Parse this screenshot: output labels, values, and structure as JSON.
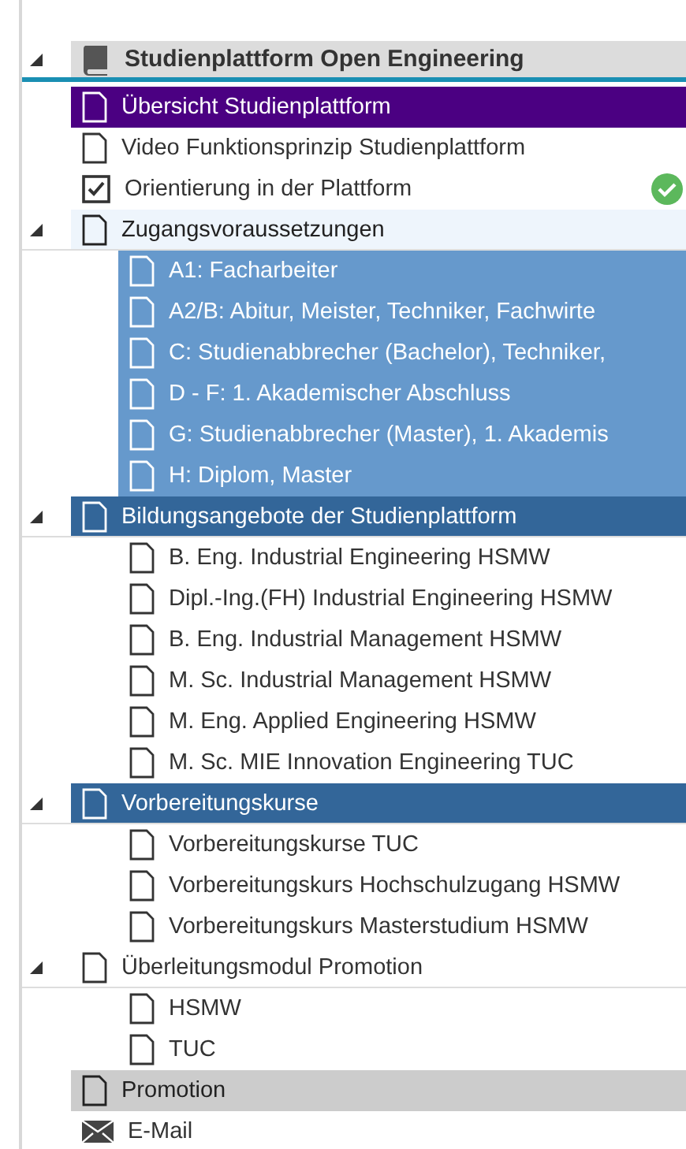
{
  "tree": {
    "label": "Studienplattform Open Engineering",
    "kind": "book",
    "expanded": true,
    "children": [
      {
        "label": "Übersicht Studienplattform",
        "kind": "page",
        "color": "#4b0082"
      },
      {
        "label": "Video Funktionsprinzip Studienplattform",
        "kind": "page"
      },
      {
        "label": "Orientierung in der Plattform",
        "kind": "checklist",
        "completed": true
      },
      {
        "label": "Zugangsvoraussetzungen",
        "kind": "page",
        "color": "#eef5fc",
        "expanded": true,
        "children": [
          {
            "label": "A1: Facharbeiter",
            "kind": "page",
            "color": "#6699cc"
          },
          {
            "label": "A2/B: Abitur, Meister, Techniker, Fachwirte",
            "kind": "page",
            "color": "#6699cc"
          },
          {
            "label": "C: Studienabbrecher (Bachelor), Techniker,",
            "kind": "page",
            "color": "#6699cc"
          },
          {
            "label": "D - F: 1. Akademischer Abschluss",
            "kind": "page",
            "color": "#6699cc"
          },
          {
            "label": "G: Studienabbrecher (Master), 1. Akademis",
            "kind": "page",
            "color": "#6699cc"
          },
          {
            "label": "H: Diplom, Master",
            "kind": "page",
            "color": "#6699cc"
          }
        ]
      },
      {
        "label": "Bildungsangebote der Studienplattform",
        "kind": "page",
        "color": "#336699",
        "expanded": true,
        "children": [
          {
            "label": "B. Eng. Industrial Engineering HSMW",
            "kind": "page"
          },
          {
            "label": "Dipl.-Ing.(FH) Industrial Engineering HSMW",
            "kind": "page"
          },
          {
            "label": "B. Eng. Industrial Management HSMW",
            "kind": "page"
          },
          {
            "label": "M. Sc. Industrial Management HSMW",
            "kind": "page"
          },
          {
            "label": "M. Eng. Applied Engineering HSMW",
            "kind": "page"
          },
          {
            "label": "M. Sc. MIE Innovation Engineering TUC",
            "kind": "page"
          }
        ]
      },
      {
        "label": "Vorbereitungskurse",
        "kind": "page",
        "color": "#336699",
        "expanded": true,
        "children": [
          {
            "label": "Vorbereitungskurse TUC",
            "kind": "page"
          },
          {
            "label": "Vorbereitungskurs Hochschulzugang HSMW",
            "kind": "page"
          },
          {
            "label": "Vorbereitungskurs Masterstudium HSMW",
            "kind": "page"
          }
        ]
      },
      {
        "label": "Überleitungsmodul Promotion",
        "kind": "page",
        "expanded": true,
        "children": [
          {
            "label": "HSMW",
            "kind": "page"
          },
          {
            "label": "TUC",
            "kind": "page"
          }
        ]
      },
      {
        "label": "Promotion",
        "kind": "page",
        "color": "#cccccc"
      },
      {
        "label": "E-Mail",
        "kind": "mail"
      }
    ]
  }
}
